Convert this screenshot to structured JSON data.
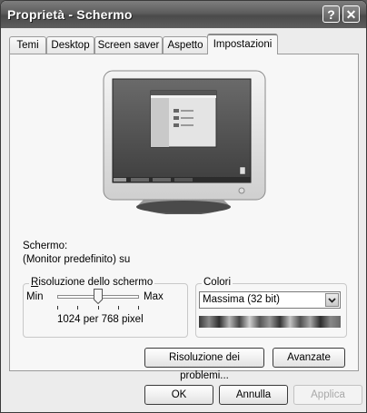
{
  "window": {
    "title": "Proprietà - Schermo"
  },
  "tabs": [
    {
      "label": "Temi"
    },
    {
      "label": "Desktop"
    },
    {
      "label": "Screen saver"
    },
    {
      "label": "Aspetto"
    },
    {
      "label": "Impostazioni",
      "active": true
    }
  ],
  "display": {
    "heading": "Schermo:",
    "device": "(Monitor predefinito) su"
  },
  "resolution": {
    "group_title": "Risoluzione dello schermo",
    "min_label": "Min",
    "max_label": "Max",
    "value_text": "1024 per 768 pixel",
    "slider_level": 0.5
  },
  "colors": {
    "group_title": "Colori",
    "selected": "Massima (32 bit)"
  },
  "buttons": {
    "troubleshoot": "Risoluzione dei problemi...",
    "advanced": "Avanzate",
    "ok": "OK",
    "cancel": "Annulla",
    "apply": "Applica"
  }
}
